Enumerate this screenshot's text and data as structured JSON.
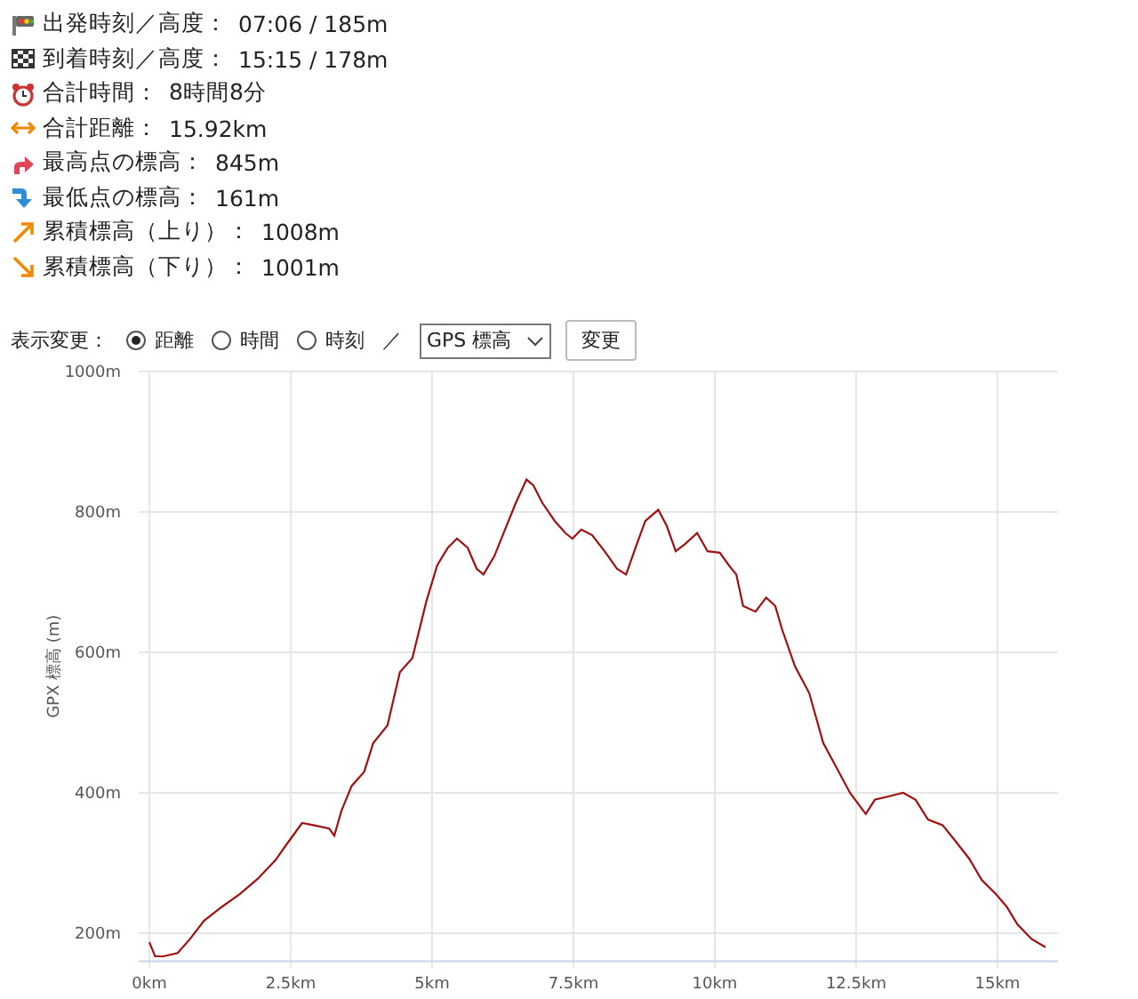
{
  "summary": [
    {
      "kind": "start",
      "label": "出発時刻／高度：",
      "value": "07:06 / 185m"
    },
    {
      "kind": "goal",
      "label": "到着時刻／高度：",
      "value": "15:15 / 178m"
    },
    {
      "kind": "time",
      "label": "合計時間：",
      "value": "8時間8分"
    },
    {
      "kind": "distance",
      "label": "合計距離：",
      "value": "15.92km"
    },
    {
      "kind": "highest",
      "label": "最高点の標高：",
      "value": "845m"
    },
    {
      "kind": "lowest",
      "label": "最低点の標高：",
      "value": "161m"
    },
    {
      "kind": "ascent",
      "label": "累積標高（上り）：",
      "value": "1008m"
    },
    {
      "kind": "descent",
      "label": "累積標高（下り）：",
      "value": "1001m"
    }
  ],
  "display_switch": {
    "label": "表示変更：",
    "options": [
      {
        "label": "距離",
        "selected": true
      },
      {
        "label": "時間",
        "selected": false
      },
      {
        "label": "時刻",
        "selected": false
      }
    ],
    "separator": "／",
    "select": {
      "value": "GPS 標高"
    },
    "button": "変更"
  },
  "chart": {
    "chart_data": {
      "type": "line",
      "grid": true,
      "ylabel": "GPX 標高 (m)",
      "xlim": [
        0,
        16.07
      ],
      "ylim": [
        160,
        1000
      ],
      "xticks": [
        {
          "value": 0,
          "label": "0km"
        },
        {
          "value": 2.5,
          "label": "2.5km"
        },
        {
          "value": 5,
          "label": "5km"
        },
        {
          "value": 7.5,
          "label": "7.5km"
        },
        {
          "value": 10,
          "label": "10km"
        },
        {
          "value": 12.5,
          "label": "12.5km"
        },
        {
          "value": 15,
          "label": "15km"
        }
      ],
      "yticks": [
        {
          "value": 200,
          "label": "200m"
        },
        {
          "value": 400,
          "label": "400m"
        },
        {
          "value": 600,
          "label": "600m"
        },
        {
          "value": 800,
          "label": "800m"
        },
        {
          "value": 1000,
          "label": "1000m"
        }
      ],
      "x": [
        0,
        0.1,
        0.25,
        0.5,
        0.72,
        0.97,
        1.29,
        1.6,
        1.92,
        2.23,
        2.45,
        2.7,
        2.9,
        3.18,
        3.27,
        3.4,
        3.58,
        3.8,
        3.96,
        4.21,
        4.43,
        4.65,
        4.9,
        5.09,
        5.28,
        5.44,
        5.63,
        5.79,
        5.91,
        6.1,
        6.29,
        6.48,
        6.67,
        6.79,
        6.95,
        7.17,
        7.36,
        7.48,
        7.64,
        7.83,
        8.05,
        8.27,
        8.43,
        8.62,
        8.77,
        9.0,
        9.15,
        9.31,
        9.47,
        9.69,
        9.87,
        10.09,
        10.25,
        10.38,
        10.5,
        10.72,
        10.91,
        11.07,
        11.19,
        11.42,
        11.67,
        11.92,
        12.14,
        12.39,
        12.67,
        12.83,
        13.08,
        13.33,
        13.55,
        13.77,
        14.03,
        14.25,
        14.5,
        14.72,
        14.97,
        15.16,
        15.35,
        15.6,
        15.85
      ],
      "series": [
        {
          "color": "#a01010",
          "values": [
            187,
            167,
            167,
            172,
            192,
            218,
            238,
            256,
            278,
            304,
            329,
            357,
            354,
            349,
            339,
            375,
            410,
            430,
            471,
            496,
            572,
            592,
            673,
            724,
            749,
            762,
            749,
            719,
            711,
            737,
            775,
            813,
            846,
            838,
            813,
            787,
            770,
            762,
            775,
            767,
            744,
            719,
            711,
            754,
            787,
            803,
            780,
            744,
            754,
            770,
            744,
            742,
            724,
            711,
            666,
            658,
            678,
            666,
            633,
            580,
            542,
            471,
            438,
            400,
            370,
            390,
            395,
            400,
            390,
            362,
            354,
            332,
            306,
            276,
            256,
            238,
            213,
            192,
            180
          ]
        }
      ]
    }
  }
}
